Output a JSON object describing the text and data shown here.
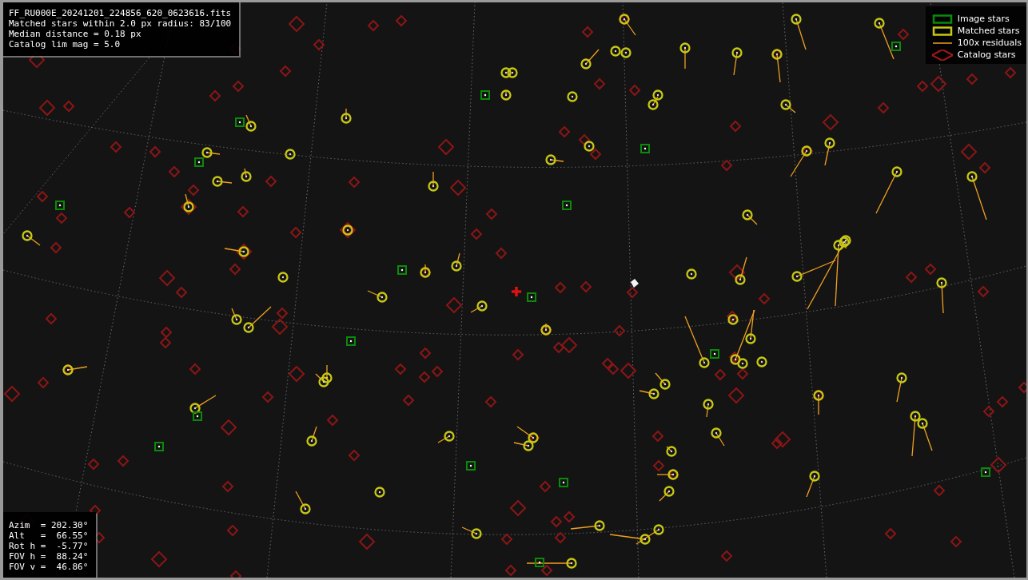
{
  "info_box": {
    "lines": [
      "FF_RU000E_20241201_224856_620_0623616.fits",
      "Matched stars within 2.0 px radius: 83/100",
      "Median distance = 0.18 px",
      "Catalog lim mag = 5.0"
    ]
  },
  "legend": [
    {
      "kind": "image",
      "label": "Image stars"
    },
    {
      "kind": "matched",
      "label": "Matched stars"
    },
    {
      "kind": "residual",
      "label": "100x residuals"
    },
    {
      "kind": "catalog",
      "label": "Catalog stars"
    }
  ],
  "pointing_box": {
    "lines": [
      "Azim  = 202.30°",
      "Alt   =  66.55°",
      "Rot h =  -5.77°",
      "FOV h =  88.24°",
      "FOV v =  46.86°"
    ]
  }
}
